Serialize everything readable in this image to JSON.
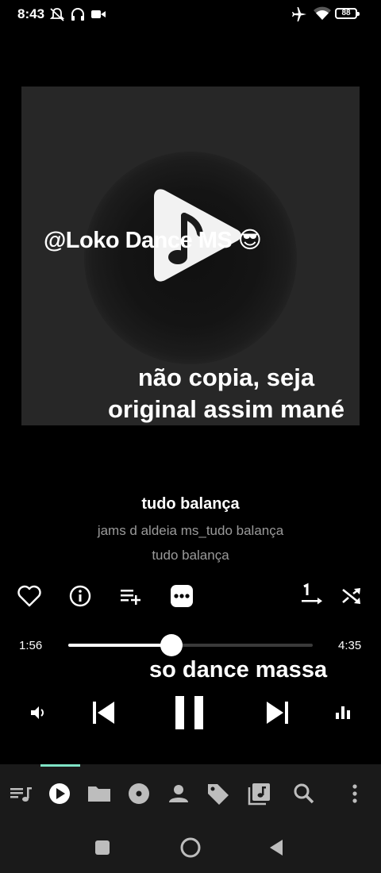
{
  "status_bar": {
    "time": "8:43",
    "battery": "88"
  },
  "artwork": {
    "overlay_channel": "@Loko Dance MS 😎",
    "overlay_caption": "não copia, seja original assim mané"
  },
  "lyric_overlay": "so dance massa",
  "song": {
    "title": "tudo balança",
    "artist": "jams d aldeia ms_tudo balança",
    "album": "tudo balança"
  },
  "actions": [
    "favorite-icon",
    "info-icon",
    "add-to-playlist-icon",
    "more-icon",
    "repeat-one-icon",
    "shuffle-icon"
  ],
  "progress": {
    "current": "1:56",
    "total": "4:35",
    "fraction": 0.421
  },
  "controls": [
    "volume-icon",
    "previous-icon",
    "pause-icon",
    "next-icon",
    "equalizer-icon"
  ],
  "bottom_nav": {
    "items": [
      "queue",
      "now-playing",
      "folders",
      "albums",
      "artists",
      "tags",
      "playlists",
      "search",
      "more"
    ],
    "active": "now-playing"
  },
  "colors": {
    "accent": "#7fe3c5",
    "background": "#000000",
    "nav_background": "#1a1a1a"
  }
}
